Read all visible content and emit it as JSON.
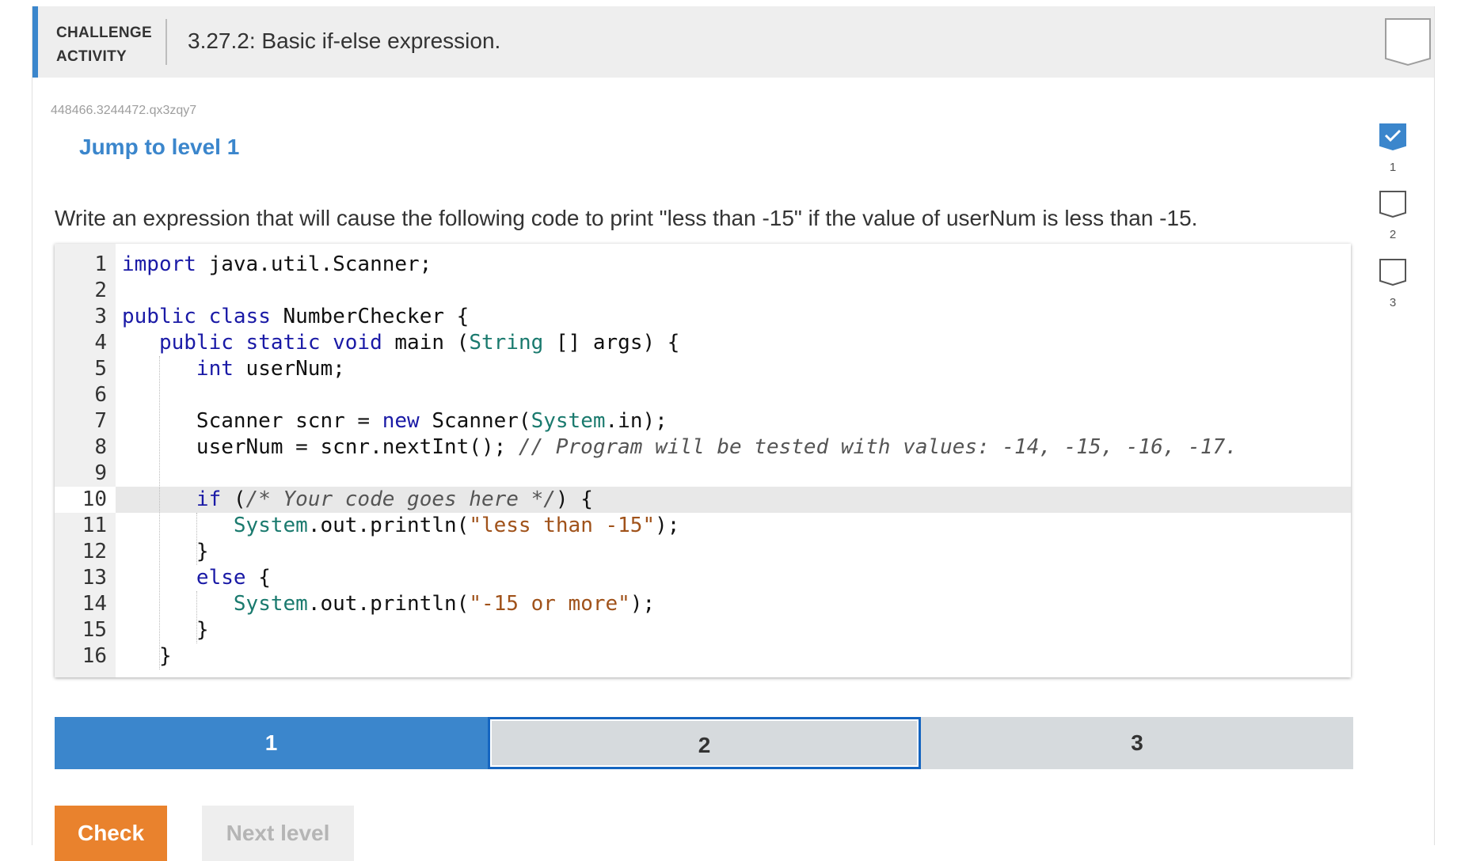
{
  "header": {
    "label_line1": "CHALLENGE",
    "label_line2": "ACTIVITY",
    "title": "3.27.2: Basic if-else expression."
  },
  "activity_id": "448466.3244472.qx3zqy7",
  "jump_link": "Jump to level 1",
  "instructions": "Write an expression that will cause the following code to print \"less than -15\" if the value of userNum is less than -15.",
  "code_lines": [
    {
      "num": "1",
      "text": "import java.util.Scanner;"
    },
    {
      "num": "2",
      "text": ""
    },
    {
      "num": "3",
      "text": "public class NumberChecker {"
    },
    {
      "num": "4",
      "text": "   public static void main (String [] args) {"
    },
    {
      "num": "5",
      "text": "      int userNum;"
    },
    {
      "num": "6",
      "text": ""
    },
    {
      "num": "7",
      "text": "      Scanner scnr = new Scanner(System.in);"
    },
    {
      "num": "8",
      "text": "      userNum = scnr.nextInt(); // Program will be tested with values: -14, -15, -16, -17."
    },
    {
      "num": "9",
      "text": ""
    },
    {
      "num": "10",
      "text": "      if (/* Your code goes here */) {"
    },
    {
      "num": "11",
      "text": "         System.out.println(\"less than -15\");"
    },
    {
      "num": "12",
      "text": "      }"
    },
    {
      "num": "13",
      "text": "      else {"
    },
    {
      "num": "14",
      "text": "         System.out.println(\"-15 or more\");"
    },
    {
      "num": "15",
      "text": "      }"
    },
    {
      "num": "16",
      "text": "   }"
    }
  ],
  "active_line": 10,
  "levels": [
    {
      "label": "1",
      "state": "completed"
    },
    {
      "label": "2",
      "state": "current"
    },
    {
      "label": "3",
      "state": "locked"
    }
  ],
  "buttons": {
    "check": "Check",
    "next_level": "Next level"
  },
  "side_levels": [
    {
      "label": "1",
      "state": "completed"
    },
    {
      "label": "2",
      "state": "empty"
    },
    {
      "label": "3",
      "state": "empty"
    }
  ],
  "colors": {
    "accent_blue": "#3b86cc",
    "check_orange": "#e9822d",
    "keyword": "#1a1aa6",
    "string": "#a0521a"
  }
}
